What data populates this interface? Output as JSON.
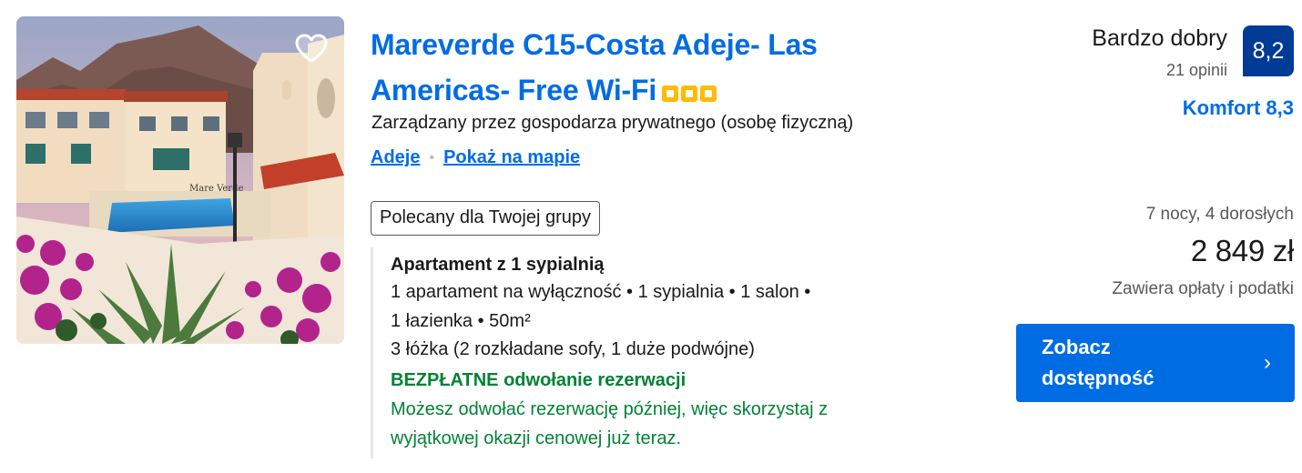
{
  "property": {
    "title": "Mareverde C15-Costa Adeje- Las Americas- Free Wi-Fi",
    "star_rating": 3,
    "managed_by": "Zarządzany przez gospodarza prywatnego (osobę fizyczną)",
    "location_link": "Adeje",
    "map_link": "Pokaż na mapie",
    "photo_sign_text": "Mare Verde"
  },
  "recommendation_badge": "Polecany dla Twojej grupy",
  "room": {
    "name": "Apartament z 1 sypialnią",
    "details_line1": "1 apartament na wyłączność • 1 sypialnia • 1 salon •",
    "details_line2": "1 łazienka • 50m²",
    "beds": "3 łóżka (2 rozkładane sofy, 1 duże podwójne)",
    "free_cancel": "BEZPŁATNE odwołanie rezerwacji",
    "cancel_note_line1": "Możesz odwołać rezerwację później, więc skorzystaj z",
    "cancel_note_line2": "wyjątkowej okazji cenowej już teraz."
  },
  "review": {
    "word": "Bardzo dobry",
    "count": "21 opinii",
    "score": "8,2",
    "comfort": "Komfort 8,3"
  },
  "pricing": {
    "stay": "7 nocy, 4 dorosłych",
    "price": "2 849 zł",
    "taxes_note": "Zawiera opłaty i podatki"
  },
  "cta": {
    "label": "Zobacz dostępność",
    "chevron": "›"
  },
  "icons": {
    "favorite": "heart-icon",
    "stars": "star-icon",
    "cta": "chevron-right-icon"
  },
  "colors": {
    "link_blue": "#006ce4",
    "score_bg": "#003b95",
    "free_cancel_green": "#008234",
    "star_yellow": "#febb02"
  }
}
